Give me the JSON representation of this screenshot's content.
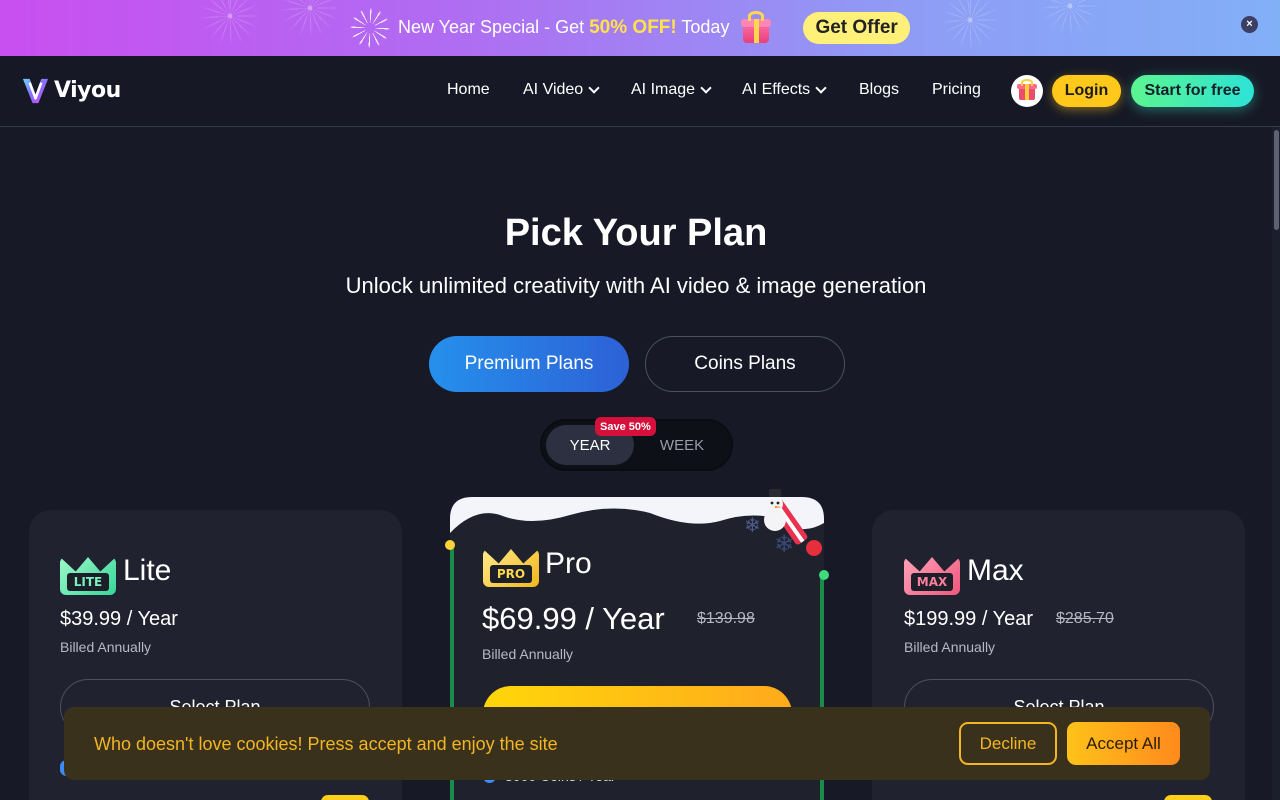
{
  "promo": {
    "text_before": "New Year Special - Get ",
    "highlight": "50% OFF!",
    "text_after": " Today",
    "cta": "Get Offer",
    "close": "×"
  },
  "header": {
    "logo_text": "Viyou",
    "nav": [
      {
        "label": "Home",
        "has_dropdown": false
      },
      {
        "label": "AI Video",
        "has_dropdown": true
      },
      {
        "label": "AI Image",
        "has_dropdown": true
      },
      {
        "label": "AI Effects",
        "has_dropdown": true
      },
      {
        "label": "Blogs",
        "has_dropdown": false
      },
      {
        "label": "Pricing",
        "has_dropdown": false
      }
    ],
    "login": "Login",
    "start": "Start for free"
  },
  "hero": {
    "title": "Pick Your Plan",
    "subtitle": "Unlock unlimited creativity with AI video & image generation"
  },
  "plan_tabs": {
    "premium": "Premium Plans",
    "coins": "Coins Plans",
    "selected": "Premium Plans"
  },
  "period": {
    "year": "YEAR",
    "week": "WEEK",
    "badge": "Save 50%",
    "selected": "YEAR"
  },
  "plans": {
    "lite": {
      "badge": "LITE",
      "name": "Lite",
      "price": "$39.99 / Year",
      "billed": "Billed Annually",
      "cta": "Select Plan"
    },
    "pro": {
      "badge": "PRO",
      "name": "Pro",
      "price": "$69.99 / Year",
      "original": "$139.98",
      "billed": "Billed Annually",
      "coins": "3000 Coins / Year"
    },
    "max": {
      "badge": "MAX",
      "name": "Max",
      "price": "$199.99 / Year",
      "original": "$285.70",
      "billed": "Billed Annually",
      "cta": "Select Plan"
    }
  },
  "cookie": {
    "text": "Who doesn't love cookies! Press accept and enjoy the site",
    "decline": "Decline",
    "accept": "Accept All"
  },
  "colors": {
    "background": "#171a26",
    "accent_blue": "#2590ec",
    "login_yellow": "#ffc81a",
    "start_green": "#5bf590",
    "cookie_text": "#f2b523"
  }
}
